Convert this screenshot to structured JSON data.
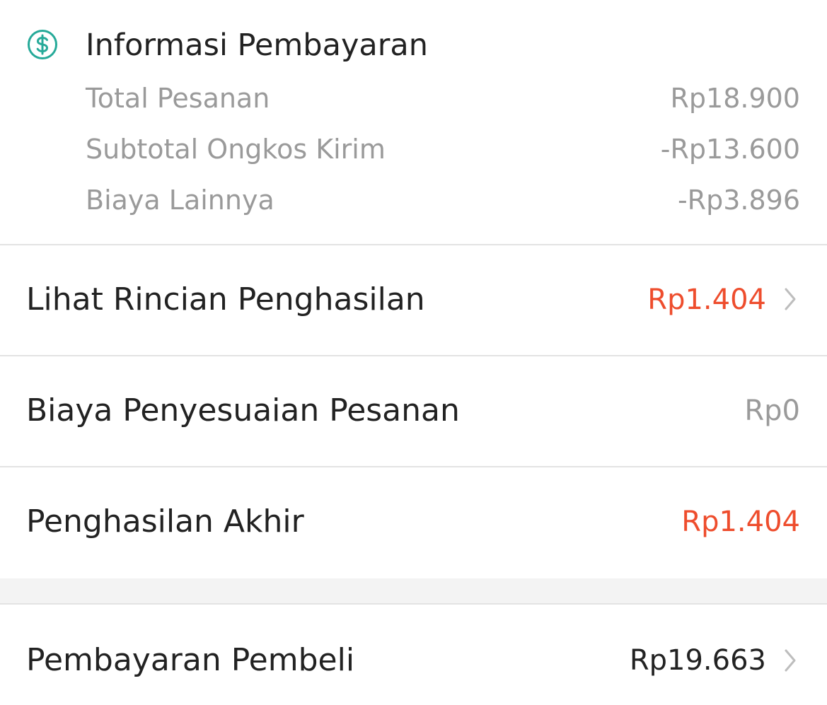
{
  "payment_info": {
    "title": "Informasi Pembayaran",
    "icon": "dollar-circle-icon",
    "icon_color": "#26aa99",
    "rows": [
      {
        "label": "Total Pesanan",
        "value": "Rp18.900"
      },
      {
        "label": "Subtotal Ongkos Kirim",
        "value": "-Rp13.600"
      },
      {
        "label": "Biaya Lainnya",
        "value": "-Rp3.896"
      }
    ]
  },
  "income_detail": {
    "label": "Lihat Rincian Penghasilan",
    "value": "Rp1.404",
    "value_color": "#ee4d2d"
  },
  "order_adjustment": {
    "label": "Biaya Penyesuaian Pesanan",
    "value": "Rp0"
  },
  "final_income": {
    "label": "Penghasilan Akhir",
    "value": "Rp1.404",
    "value_color": "#ee4d2d"
  },
  "buyer_payment": {
    "label": "Pembayaran Pembeli",
    "value": "Rp19.663"
  }
}
